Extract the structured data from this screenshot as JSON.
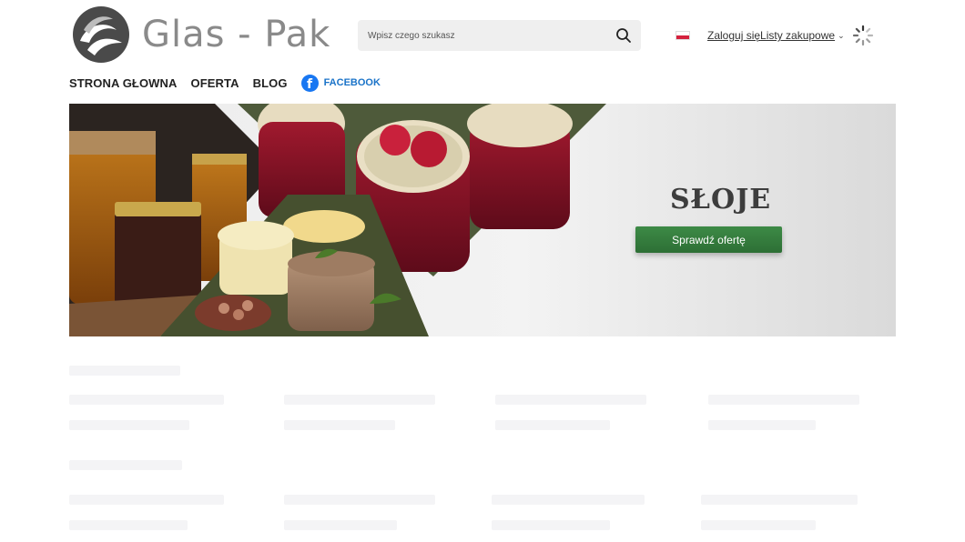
{
  "header": {
    "logo_text": "Glas - Pak",
    "search": {
      "placeholder": "Wpisz czego szukasz"
    },
    "login_label": "Zaloguj się",
    "shopping_lists_label": "Listy zakupowe"
  },
  "nav": {
    "items": [
      {
        "label": "STRONA GŁOWNA"
      },
      {
        "label": "OFERTA"
      },
      {
        "label": "BLOG"
      }
    ],
    "facebook_label": "FACEBOOK"
  },
  "banner": {
    "title": "SŁOJE",
    "cta_label": "Sprawdź ofertę"
  },
  "colors": {
    "accent_green": "#2f7a3a",
    "facebook_blue": "#1877f2",
    "logo_gray": "#8a8a8a"
  }
}
